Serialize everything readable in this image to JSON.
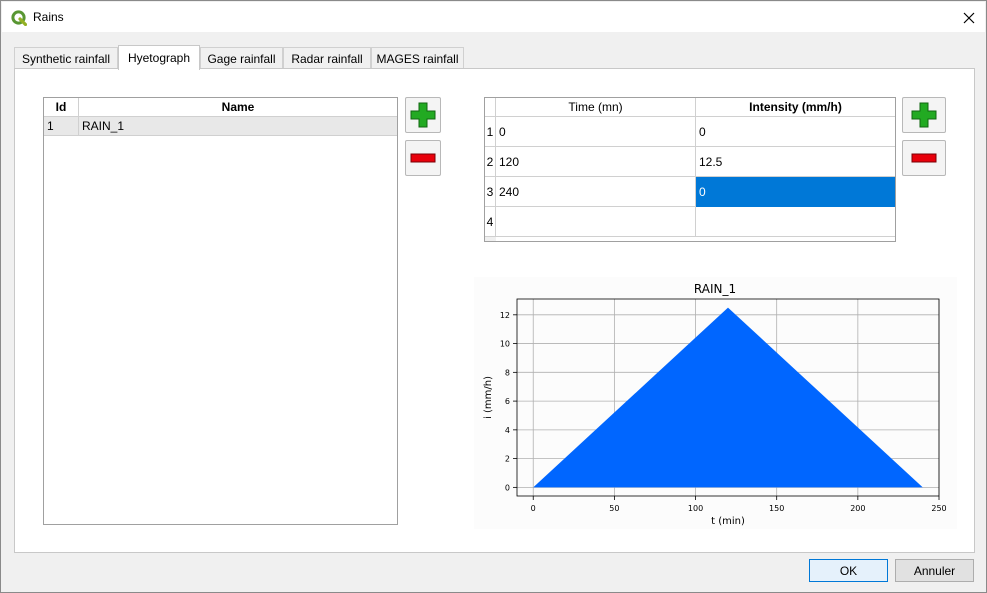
{
  "window": {
    "title": "Rains",
    "close_glyph": "✕"
  },
  "tabs": [
    {
      "label": "Synthetic rainfall",
      "active": false
    },
    {
      "label": "Hyetograph",
      "active": true
    },
    {
      "label": "Gage rainfall",
      "active": false
    },
    {
      "label": "Radar rainfall",
      "active": false
    },
    {
      "label": "MAGES rainfall",
      "active": false
    }
  ],
  "rains_table": {
    "headers": {
      "id": "Id",
      "name": "Name"
    },
    "rows": [
      {
        "id": "1",
        "name": "RAIN_1"
      }
    ]
  },
  "hyeto_table": {
    "headers": {
      "time": "Time (mn)",
      "intensity": "Intensity (mm/h)"
    },
    "rows": [
      {
        "num": "1",
        "time": "0",
        "intensity": "0"
      },
      {
        "num": "2",
        "time": "120",
        "intensity": "12.5"
      },
      {
        "num": "3",
        "time": "240",
        "intensity": "0"
      },
      {
        "num": "4",
        "time": "",
        "intensity": ""
      }
    ]
  },
  "buttons": {
    "ok": "OK",
    "cancel": "Annuler"
  },
  "icons": {
    "add": "plus-icon",
    "remove": "minus-icon",
    "close": "close-icon",
    "app": "qgis-logo-icon"
  },
  "colors": {
    "accent": "#0078d7",
    "fill": "#0066ff",
    "add": "#22aa22",
    "remove": "#e8000b"
  },
  "chart_data": {
    "type": "area",
    "title": "RAIN_1",
    "xlabel": "t (min)",
    "ylabel": "i (mm/h)",
    "x": [
      0,
      120,
      240
    ],
    "y": [
      0,
      12.5,
      0
    ],
    "xlim": [
      -10,
      250
    ],
    "ylim": [
      -0.6,
      13.1
    ],
    "xticks": [
      0,
      50,
      100,
      150,
      200,
      250
    ],
    "yticks": [
      0,
      2,
      4,
      6,
      8,
      10,
      12
    ],
    "grid": true
  }
}
